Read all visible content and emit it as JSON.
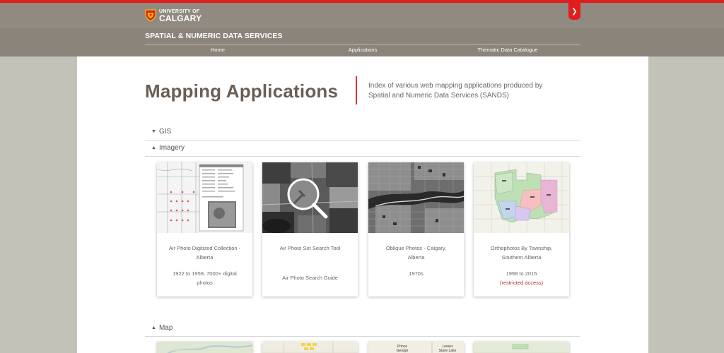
{
  "header": {
    "logo_line1": "UNIVERSITY OF",
    "logo_line2": "CALGARY",
    "site_title": "SPATIAL & NUMERIC DATA SERVICES",
    "nav": [
      "Home",
      "Applications",
      "Thematic Data Catalogue"
    ]
  },
  "page": {
    "title": "Mapping Applications",
    "intro_line1": "Index of various web mapping applications produced by",
    "intro_line2": "Spatial and Numeric Data Services (SANDS)"
  },
  "sections": {
    "gis": "GIS",
    "imagery": "Imagery",
    "map": "Map"
  },
  "cards": [
    {
      "title_line1": "Air Photo Digitized Collection -",
      "title_line2": "Alberta",
      "sub_line1": "1922 to 1959, 7000+ digital",
      "sub_line2": "photos",
      "note": ""
    },
    {
      "title_line1": "Air Photo Set Search Tool",
      "title_line2": "",
      "sub_line1": "Air Photo Search Guide",
      "sub_line2": "",
      "note": ""
    },
    {
      "title_line1": "Oblique Photos - Calgary,",
      "title_line2": "Alberta",
      "sub_line1": "1970s",
      "sub_line2": "",
      "note": ""
    },
    {
      "title_line1": "Orthophotos By Township,",
      "title_line2": "Southern Alberta",
      "sub_line1": "1998 to 2015",
      "sub_line2": "",
      "note": "(restricted access)"
    }
  ],
  "map_thumbs": {
    "label_a": "Prince",
    "label_b": "George",
    "label_c": "Lesser",
    "label_d": "Slave Lake"
  },
  "colors": {
    "accent": "#e01e1e",
    "header": "#8a847b",
    "title": "#6b5e55",
    "note": "#c0282d"
  },
  "icons": [
    "shield-logo-icon",
    "chevron-down-icon",
    "triangle-down-icon",
    "triangle-up-icon",
    "magnifier-icon"
  ]
}
